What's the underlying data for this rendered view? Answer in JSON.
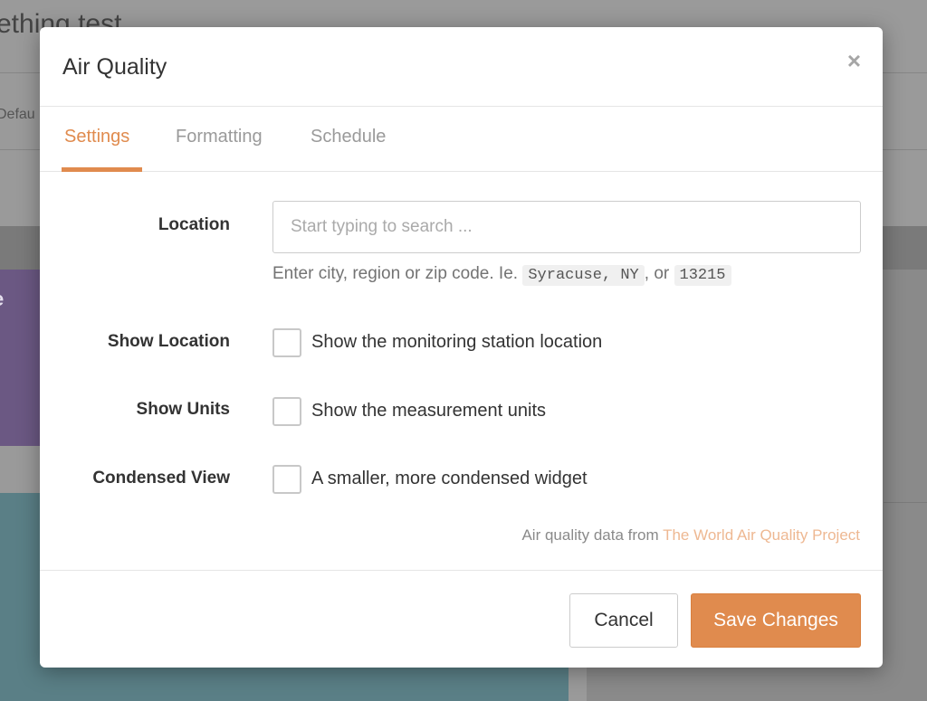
{
  "background": {
    "title": "ething test",
    "subtab": "Defau",
    "card_label": "e"
  },
  "modal": {
    "title": "Air Quality",
    "close_symbol": "×",
    "tabs": [
      {
        "label": "Settings",
        "active": true
      },
      {
        "label": "Formatting",
        "active": false
      },
      {
        "label": "Schedule",
        "active": false
      }
    ],
    "location": {
      "label": "Location",
      "placeholder": "Start typing to search ...",
      "value": "",
      "help_prefix": "Enter city, region or zip code. Ie.",
      "help_example1": "Syracuse, NY",
      "help_mid": ", or",
      "help_example2": "13215"
    },
    "show_location": {
      "label": "Show Location",
      "checkbox_label": "Show the monitoring station location",
      "checked": false
    },
    "show_units": {
      "label": "Show Units",
      "checkbox_label": "Show the measurement units",
      "checked": false
    },
    "condensed_view": {
      "label": "Condensed View",
      "checkbox_label": "A smaller, more condensed widget",
      "checked": false
    },
    "attribution": {
      "prefix": "Air quality data from",
      "link_text": "The World Air Quality Project"
    },
    "footer": {
      "cancel_label": "Cancel",
      "save_label": "Save Changes"
    }
  },
  "colors": {
    "accent": "#e08b4e",
    "link": "#eeb892"
  }
}
